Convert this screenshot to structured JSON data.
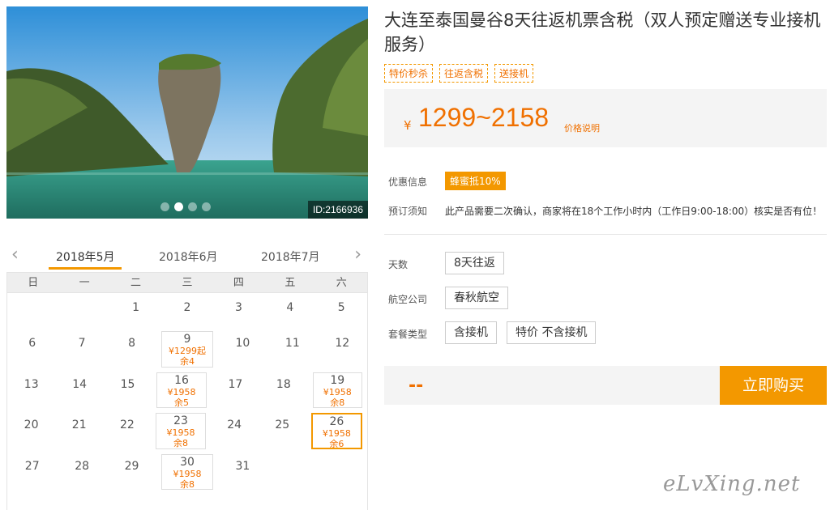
{
  "photo": {
    "id_label": "ID:2166936",
    "slides": 4,
    "active_slide": 2
  },
  "calendar": {
    "prev_icon": "chevron-left-icon",
    "next_icon": "chevron-right-icon",
    "months": [
      "2018年5月",
      "2018年6月",
      "2018年7月"
    ],
    "active_month": 0,
    "weekdays": [
      "日",
      "一",
      "二",
      "三",
      "四",
      "五",
      "六"
    ],
    "rows": [
      [
        {
          "d": ""
        },
        {
          "d": ""
        },
        {
          "d": "1"
        },
        {
          "d": "2"
        },
        {
          "d": "3"
        },
        {
          "d": "4"
        },
        {
          "d": "5"
        }
      ],
      [
        {
          "d": "6"
        },
        {
          "d": "7"
        },
        {
          "d": "8"
        },
        {
          "d": "9",
          "price": "¥1299起",
          "left": "余4"
        },
        {
          "d": "10"
        },
        {
          "d": "11"
        },
        {
          "d": "12"
        }
      ],
      [
        {
          "d": "13"
        },
        {
          "d": "14"
        },
        {
          "d": "15"
        },
        {
          "d": "16",
          "price": "¥1958",
          "left": "余5"
        },
        {
          "d": "17"
        },
        {
          "d": "18"
        },
        {
          "d": "19",
          "price": "¥1958",
          "left": "余8"
        }
      ],
      [
        {
          "d": "20"
        },
        {
          "d": "21"
        },
        {
          "d": "22"
        },
        {
          "d": "23",
          "price": "¥1958",
          "left": "余8"
        },
        {
          "d": "24"
        },
        {
          "d": "25"
        },
        {
          "d": "26",
          "price": "¥1958",
          "left": "余6",
          "selected": true
        }
      ],
      [
        {
          "d": "27"
        },
        {
          "d": "28"
        },
        {
          "d": "29"
        },
        {
          "d": "30",
          "price": "¥1958",
          "left": "余8"
        },
        {
          "d": "31"
        },
        {
          "d": ""
        },
        {
          "d": ""
        }
      ]
    ]
  },
  "product": {
    "title": "大连至泰国曼谷8天往返机票含税（双人预定赠送专业接机服务）",
    "tags": [
      "特价秒杀",
      "往返含税",
      "送接机"
    ],
    "currency": "¥",
    "price_range": "1299~2158",
    "price_note": "价格说明",
    "promo_label": "优惠信息",
    "promo_badge": "蜂蜜抵10%",
    "notice_label": "预订须知",
    "notice_text": "此产品需要二次确认，商家将在18个工作小时内（工作日9:00-18:00）核实是否有位！"
  },
  "options": {
    "days_label": "天数",
    "days": [
      "8天往返"
    ],
    "airline_label": "航空公司",
    "airlines": [
      "春秋航空"
    ],
    "package_label": "套餐类型",
    "packages": [
      "含接机",
      "特价 不含接机"
    ]
  },
  "purchase": {
    "quantity": "--",
    "buy_label": "立即购买"
  },
  "watermark": "eLvXing.net",
  "colors": {
    "accent": "#f39800",
    "price": "#f07000"
  }
}
